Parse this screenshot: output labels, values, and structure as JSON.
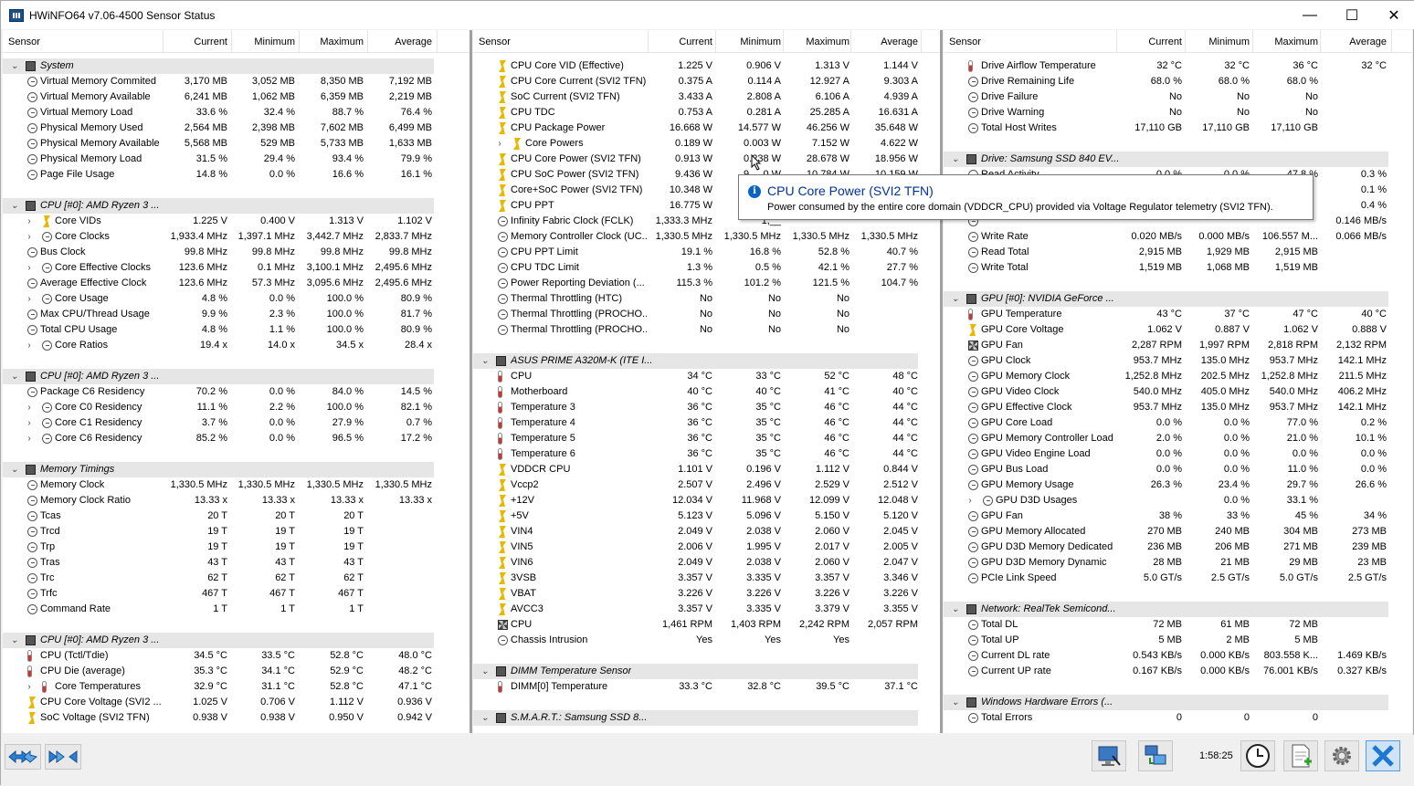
{
  "window": {
    "title": "HWiNFO64 v7.06-4500 Sensor Status",
    "minimize": "—",
    "maximize": "☐",
    "close": "✕"
  },
  "columns": {
    "sensor": "Sensor",
    "current": "Current",
    "minimum": "Minimum",
    "maximum": "Maximum",
    "average": "Average"
  },
  "panel1": [
    {
      "t": "sec",
      "l": "System",
      "i": "chip",
      "lv": 0
    },
    {
      "l": "Virtual Memory Commited",
      "i": "clock",
      "c": "3,170 MB",
      "mn": "3,052 MB",
      "mx": "8,350 MB",
      "av": "7,192 MB"
    },
    {
      "l": "Virtual Memory Available",
      "i": "clock",
      "c": "6,241 MB",
      "mn": "1,062 MB",
      "mx": "6,359 MB",
      "av": "2,219 MB"
    },
    {
      "l": "Virtual Memory Load",
      "i": "clock",
      "c": "33.6 %",
      "mn": "32.4 %",
      "mx": "88.7 %",
      "av": "76.4 %"
    },
    {
      "l": "Physical Memory Used",
      "i": "clock",
      "c": "2,564 MB",
      "mn": "2,398 MB",
      "mx": "7,602 MB",
      "av": "6,499 MB"
    },
    {
      "l": "Physical Memory Available",
      "i": "clock",
      "c": "5,568 MB",
      "mn": "529 MB",
      "mx": "5,733 MB",
      "av": "1,633 MB"
    },
    {
      "l": "Physical Memory Load",
      "i": "clock",
      "c": "31.5 %",
      "mn": "29.4 %",
      "mx": "93.4 %",
      "av": "79.9 %"
    },
    {
      "l": "Page File Usage",
      "i": "clock",
      "c": "14.8 %",
      "mn": "0.0 %",
      "mx": "16.6 %",
      "av": "16.1 %"
    },
    {
      "t": "blank"
    },
    {
      "t": "sec",
      "l": "CPU [#0]: AMD Ryzen 3 ...",
      "i": "chip"
    },
    {
      "l": "Core VIDs",
      "i": "volt",
      "e": 1,
      "c": "1.225 V",
      "mn": "0.400 V",
      "mx": "1.313 V",
      "av": "1.102 V"
    },
    {
      "l": "Core Clocks",
      "i": "clock",
      "e": 1,
      "c": "1,933.4 MHz",
      "mn": "1,397.1 MHz",
      "mx": "3,442.7 MHz",
      "av": "2,833.7 MHz"
    },
    {
      "l": "Bus Clock",
      "i": "clock",
      "c": "99.8 MHz",
      "mn": "99.8 MHz",
      "mx": "99.8 MHz",
      "av": "99.8 MHz"
    },
    {
      "l": "Core Effective Clocks",
      "i": "clock",
      "e": 1,
      "c": "123.6 MHz",
      "mn": "0.1 MHz",
      "mx": "3,100.1 MHz",
      "av": "2,495.6 MHz"
    },
    {
      "l": "Average Effective Clock",
      "i": "clock",
      "c": "123.6 MHz",
      "mn": "57.3 MHz",
      "mx": "3,095.6 MHz",
      "av": "2,495.6 MHz"
    },
    {
      "l": "Core Usage",
      "i": "clock",
      "e": 1,
      "c": "4.8 %",
      "mn": "0.0 %",
      "mx": "100.0 %",
      "av": "80.9 %"
    },
    {
      "l": "Max CPU/Thread Usage",
      "i": "clock",
      "c": "9.9 %",
      "mn": "2.3 %",
      "mx": "100.0 %",
      "av": "81.7 %"
    },
    {
      "l": "Total CPU Usage",
      "i": "clock",
      "c": "4.8 %",
      "mn": "1.1 %",
      "mx": "100.0 %",
      "av": "80.9 %"
    },
    {
      "l": "Core Ratios",
      "i": "clock",
      "e": 1,
      "c": "19.4 x",
      "mn": "14.0 x",
      "mx": "34.5 x",
      "av": "28.4 x"
    },
    {
      "t": "blank"
    },
    {
      "t": "sec",
      "l": "CPU [#0]: AMD Ryzen 3 ...",
      "i": "chip"
    },
    {
      "l": "Package C6 Residency",
      "i": "clock",
      "c": "70.2 %",
      "mn": "0.0 %",
      "mx": "84.0 %",
      "av": "14.5 %"
    },
    {
      "l": "Core C0 Residency",
      "i": "clock",
      "e": 1,
      "c": "11.1 %",
      "mn": "2.2 %",
      "mx": "100.0 %",
      "av": "82.1 %"
    },
    {
      "l": "Core C1 Residency",
      "i": "clock",
      "e": 1,
      "c": "3.7 %",
      "mn": "0.0 %",
      "mx": "27.9 %",
      "av": "0.7 %"
    },
    {
      "l": "Core C6 Residency",
      "i": "clock",
      "e": 1,
      "c": "85.2 %",
      "mn": "0.0 %",
      "mx": "96.5 %",
      "av": "17.2 %"
    },
    {
      "t": "blank"
    },
    {
      "t": "sec",
      "l": "Memory Timings",
      "i": "chip"
    },
    {
      "l": "Memory Clock",
      "i": "clock",
      "c": "1,330.5 MHz",
      "mn": "1,330.5 MHz",
      "mx": "1,330.5 MHz",
      "av": "1,330.5 MHz"
    },
    {
      "l": "Memory Clock Ratio",
      "i": "clock",
      "c": "13.33 x",
      "mn": "13.33 x",
      "mx": "13.33 x",
      "av": "13.33 x"
    },
    {
      "l": "Tcas",
      "i": "clock",
      "c": "20 T",
      "mn": "20 T",
      "mx": "20 T",
      "av": ""
    },
    {
      "l": "Trcd",
      "i": "clock",
      "c": "19 T",
      "mn": "19 T",
      "mx": "19 T",
      "av": ""
    },
    {
      "l": "Trp",
      "i": "clock",
      "c": "19 T",
      "mn": "19 T",
      "mx": "19 T",
      "av": ""
    },
    {
      "l": "Tras",
      "i": "clock",
      "c": "43 T",
      "mn": "43 T",
      "mx": "43 T",
      "av": ""
    },
    {
      "l": "Trc",
      "i": "clock",
      "c": "62 T",
      "mn": "62 T",
      "mx": "62 T",
      "av": ""
    },
    {
      "l": "Trfc",
      "i": "clock",
      "c": "467 T",
      "mn": "467 T",
      "mx": "467 T",
      "av": ""
    },
    {
      "l": "Command Rate",
      "i": "clock",
      "c": "1 T",
      "mn": "1 T",
      "mx": "1 T",
      "av": ""
    },
    {
      "t": "blank"
    },
    {
      "t": "sec",
      "l": "CPU [#0]: AMD Ryzen 3 ...",
      "i": "chip"
    },
    {
      "l": "CPU (Tctl/Tdie)",
      "i": "temp",
      "c": "34.5 °C",
      "mn": "33.5 °C",
      "mx": "52.8 °C",
      "av": "48.0 °C"
    },
    {
      "l": "CPU Die (average)",
      "i": "temp",
      "c": "35.3 °C",
      "mn": "34.1 °C",
      "mx": "52.9 °C",
      "av": "48.2 °C"
    },
    {
      "l": "Core Temperatures",
      "i": "temp",
      "e": 1,
      "c": "32.9 °C",
      "mn": "31.1 °C",
      "mx": "52.8 °C",
      "av": "47.1 °C"
    },
    {
      "l": "CPU Core Voltage (SVI2 ...",
      "i": "volt",
      "c": "1.025 V",
      "mn": "0.706 V",
      "mx": "1.112 V",
      "av": "0.936 V"
    },
    {
      "l": "SoC Voltage (SVI2 TFN)",
      "i": "volt",
      "c": "0.938 V",
      "mn": "0.938 V",
      "mx": "0.950 V",
      "av": "0.942 V"
    }
  ],
  "panel2": [
    {
      "l": "CPU Core VID (Effective)",
      "i": "volt",
      "c": "1.225 V",
      "mn": "0.906 V",
      "mx": "1.313 V",
      "av": "1.144 V"
    },
    {
      "l": "CPU Core Current (SVI2 TFN)",
      "i": "volt",
      "c": "0.375 A",
      "mn": "0.114 A",
      "mx": "12.927 A",
      "av": "9.303 A"
    },
    {
      "l": "SoC Current (SVI2 TFN)",
      "i": "volt",
      "c": "3.433 A",
      "mn": "2.808 A",
      "mx": "6.106 A",
      "av": "4.939 A"
    },
    {
      "l": "CPU TDC",
      "i": "volt",
      "c": "0.753 A",
      "mn": "0.281 A",
      "mx": "25.285 A",
      "av": "16.631 A"
    },
    {
      "l": "CPU Package Power",
      "i": "volt",
      "c": "16.668 W",
      "mn": "14.577 W",
      "mx": "46.256 W",
      "av": "35.648 W"
    },
    {
      "l": "Core Powers",
      "i": "volt",
      "e": 1,
      "c": "0.189 W",
      "mn": "0.003 W",
      "mx": "7.152 W",
      "av": "4.622 W"
    },
    {
      "l": "CPU Core Power (SVI2 TFN)",
      "i": "volt",
      "c": "0.913 W",
      "mn": "0.238 W",
      "mx": "28.678 W",
      "av": "18.956 W"
    },
    {
      "l": "CPU SoC Power (SVI2 TFN)",
      "i": "volt",
      "c": "9.436 W",
      "mn": "9.__0 W",
      "mx": "10.784 W",
      "av": "10.159 W"
    },
    {
      "l": "Core+SoC Power (SVI2 TFN)",
      "i": "volt",
      "c": "10.348 W",
      "mn": "",
      "mx": "",
      "av": ""
    },
    {
      "l": "CPU PPT",
      "i": "volt",
      "c": "16.775 W",
      "mn": "",
      "mx": "",
      "av": ""
    },
    {
      "l": "Infinity Fabric Clock (FCLK)",
      "i": "clock",
      "c": "1,333.3 MHz",
      "mn": "1,__",
      "mx": "",
      "av": ""
    },
    {
      "l": "Memory Controller Clock (UC...",
      "i": "clock",
      "c": "1,330.5 MHz",
      "mn": "1,330.5 MHz",
      "mx": "1,330.5 MHz",
      "av": "1,330.5 MHz"
    },
    {
      "l": "CPU PPT Limit",
      "i": "clock",
      "c": "19.1 %",
      "mn": "16.8 %",
      "mx": "52.8 %",
      "av": "40.7 %"
    },
    {
      "l": "CPU TDC Limit",
      "i": "clock",
      "c": "1.3 %",
      "mn": "0.5 %",
      "mx": "42.1 %",
      "av": "27.7 %"
    },
    {
      "l": "Power Reporting Deviation (...",
      "i": "clock",
      "c": "115.3 %",
      "mn": "101.2 %",
      "mx": "121.5 %",
      "av": "104.7 %"
    },
    {
      "l": "Thermal Throttling (HTC)",
      "i": "clock",
      "c": "No",
      "mn": "No",
      "mx": "No",
      "av": ""
    },
    {
      "l": "Thermal Throttling (PROCHO...",
      "i": "clock",
      "c": "No",
      "mn": "No",
      "mx": "No",
      "av": ""
    },
    {
      "l": "Thermal Throttling (PROCHO...",
      "i": "clock",
      "c": "No",
      "mn": "No",
      "mx": "No",
      "av": ""
    },
    {
      "t": "blank"
    },
    {
      "t": "sec",
      "l": "ASUS PRIME A320M-K (ITE I...",
      "i": "chip"
    },
    {
      "l": "CPU",
      "i": "temp",
      "c": "34 °C",
      "mn": "33 °C",
      "mx": "52 °C",
      "av": "48 °C"
    },
    {
      "l": "Motherboard",
      "i": "temp",
      "c": "40 °C",
      "mn": "40 °C",
      "mx": "41 °C",
      "av": "40 °C"
    },
    {
      "l": "Temperature 3",
      "i": "temp",
      "c": "36 °C",
      "mn": "35 °C",
      "mx": "46 °C",
      "av": "44 °C"
    },
    {
      "l": "Temperature 4",
      "i": "temp",
      "c": "36 °C",
      "mn": "35 °C",
      "mx": "46 °C",
      "av": "44 °C"
    },
    {
      "l": "Temperature 5",
      "i": "temp",
      "c": "36 °C",
      "mn": "35 °C",
      "mx": "46 °C",
      "av": "44 °C"
    },
    {
      "l": "Temperature 6",
      "i": "temp",
      "c": "36 °C",
      "mn": "35 °C",
      "mx": "46 °C",
      "av": "44 °C"
    },
    {
      "l": "VDDCR CPU",
      "i": "volt",
      "c": "1.101 V",
      "mn": "0.196 V",
      "mx": "1.112 V",
      "av": "0.844 V"
    },
    {
      "l": "Vccp2",
      "i": "volt",
      "c": "2.507 V",
      "mn": "2.496 V",
      "mx": "2.529 V",
      "av": "2.512 V"
    },
    {
      "l": "+12V",
      "i": "volt",
      "c": "12.034 V",
      "mn": "11.968 V",
      "mx": "12.099 V",
      "av": "12.048 V"
    },
    {
      "l": "+5V",
      "i": "volt",
      "c": "5.123 V",
      "mn": "5.096 V",
      "mx": "5.150 V",
      "av": "5.120 V"
    },
    {
      "l": "VIN4",
      "i": "volt",
      "c": "2.049 V",
      "mn": "2.038 V",
      "mx": "2.060 V",
      "av": "2.045 V"
    },
    {
      "l": "VIN5",
      "i": "volt",
      "c": "2.006 V",
      "mn": "1.995 V",
      "mx": "2.017 V",
      "av": "2.005 V"
    },
    {
      "l": "VIN6",
      "i": "volt",
      "c": "2.049 V",
      "mn": "2.038 V",
      "mx": "2.060 V",
      "av": "2.047 V"
    },
    {
      "l": "3VSB",
      "i": "volt",
      "c": "3.357 V",
      "mn": "3.335 V",
      "mx": "3.357 V",
      "av": "3.346 V"
    },
    {
      "l": "VBAT",
      "i": "volt",
      "c": "3.226 V",
      "mn": "3.226 V",
      "mx": "3.226 V",
      "av": "3.226 V"
    },
    {
      "l": "AVCC3",
      "i": "volt",
      "c": "3.357 V",
      "mn": "3.335 V",
      "mx": "3.379 V",
      "av": "3.355 V"
    },
    {
      "l": "CPU",
      "i": "fan",
      "c": "1,461 RPM",
      "mn": "1,403 RPM",
      "mx": "2,242 RPM",
      "av": "2,057 RPM"
    },
    {
      "l": "Chassis Intrusion",
      "i": "clock",
      "c": "Yes",
      "mn": "Yes",
      "mx": "Yes",
      "av": ""
    },
    {
      "t": "blank"
    },
    {
      "t": "sec",
      "l": "DIMM Temperature Sensor",
      "i": "chip"
    },
    {
      "l": "DIMM[0] Temperature",
      "i": "temp",
      "c": "33.3 °C",
      "mn": "32.8 °C",
      "mx": "39.5 °C",
      "av": "37.1 °C"
    },
    {
      "t": "blank"
    },
    {
      "t": "sec",
      "l": "S.M.A.R.T.: Samsung SSD 8...",
      "i": "chip"
    }
  ],
  "panel3": [
    {
      "l": "Drive Airflow Temperature",
      "i": "temp",
      "c": "32 °C",
      "mn": "32 °C",
      "mx": "36 °C",
      "av": "32 °C"
    },
    {
      "l": "Drive Remaining Life",
      "i": "clock",
      "c": "68.0 %",
      "mn": "68.0 %",
      "mx": "68.0 %",
      "av": ""
    },
    {
      "l": "Drive Failure",
      "i": "clock",
      "c": "No",
      "mn": "No",
      "mx": "No",
      "av": ""
    },
    {
      "l": "Drive Warning",
      "i": "clock",
      "c": "No",
      "mn": "No",
      "mx": "No",
      "av": ""
    },
    {
      "l": "Total Host Writes",
      "i": "clock",
      "c": "17,110 GB",
      "mn": "17,110 GB",
      "mx": "17,110 GB",
      "av": ""
    },
    {
      "t": "blank"
    },
    {
      "t": "sec",
      "l": "Drive: Samsung SSD 840 EV...",
      "i": "chip"
    },
    {
      "l": "Read Activity",
      "i": "clock",
      "c": "0.0 %",
      "mn": "0.0 %",
      "mx": "47.8 %",
      "av": "0.3 %"
    },
    {
      "l": "",
      "i": "clock",
      "c": "",
      "mn": "",
      "mx": "",
      "av": "0.1 %"
    },
    {
      "l": "",
      "i": "clock",
      "c": "",
      "mn": "",
      "mx": "",
      "av": "0.4 %"
    },
    {
      "l": "",
      "i": "clock",
      "c": "",
      "mn": "",
      "mx": "",
      "av": "0.146 MB/s"
    },
    {
      "l": "Write Rate",
      "i": "clock",
      "c": "0.020 MB/s",
      "mn": "0.000 MB/s",
      "mx": "106.557 M...",
      "av": "0.066 MB/s"
    },
    {
      "l": "Read Total",
      "i": "clock",
      "c": "2,915 MB",
      "mn": "1,929 MB",
      "mx": "2,915 MB",
      "av": ""
    },
    {
      "l": "Write Total",
      "i": "clock",
      "c": "1,519 MB",
      "mn": "1,068 MB",
      "mx": "1,519 MB",
      "av": ""
    },
    {
      "t": "blank"
    },
    {
      "t": "sec",
      "l": "GPU [#0]: NVIDIA GeForce ...",
      "i": "chip"
    },
    {
      "l": "GPU Temperature",
      "i": "temp",
      "c": "43 °C",
      "mn": "37 °C",
      "mx": "47 °C",
      "av": "40 °C"
    },
    {
      "l": "GPU Core Voltage",
      "i": "volt",
      "c": "1.062 V",
      "mn": "0.887 V",
      "mx": "1.062 V",
      "av": "0.888 V"
    },
    {
      "l": "GPU Fan",
      "i": "fan",
      "c": "2,287 RPM",
      "mn": "1,997 RPM",
      "mx": "2,818 RPM",
      "av": "2,132 RPM"
    },
    {
      "l": "GPU Clock",
      "i": "clock",
      "c": "953.7 MHz",
      "mn": "135.0 MHz",
      "mx": "953.7 MHz",
      "av": "142.1 MHz"
    },
    {
      "l": "GPU Memory Clock",
      "i": "clock",
      "c": "1,252.8 MHz",
      "mn": "202.5 MHz",
      "mx": "1,252.8 MHz",
      "av": "211.5 MHz"
    },
    {
      "l": "GPU Video Clock",
      "i": "clock",
      "c": "540.0 MHz",
      "mn": "405.0 MHz",
      "mx": "540.0 MHz",
      "av": "406.2 MHz"
    },
    {
      "l": "GPU Effective Clock",
      "i": "clock",
      "c": "953.7 MHz",
      "mn": "135.0 MHz",
      "mx": "953.7 MHz",
      "av": "142.1 MHz"
    },
    {
      "l": "GPU Core Load",
      "i": "clock",
      "c": "0.0 %",
      "mn": "0.0 %",
      "mx": "77.0 %",
      "av": "0.2 %"
    },
    {
      "l": "GPU Memory Controller Load",
      "i": "clock",
      "c": "2.0 %",
      "mn": "0.0 %",
      "mx": "21.0 %",
      "av": "10.1 %"
    },
    {
      "l": "GPU Video Engine Load",
      "i": "clock",
      "c": "0.0 %",
      "mn": "0.0 %",
      "mx": "0.0 %",
      "av": "0.0 %"
    },
    {
      "l": "GPU Bus Load",
      "i": "clock",
      "c": "0.0 %",
      "mn": "0.0 %",
      "mx": "11.0 %",
      "av": "0.0 %"
    },
    {
      "l": "GPU Memory Usage",
      "i": "clock",
      "c": "26.3 %",
      "mn": "23.4 %",
      "mx": "29.7 %",
      "av": "26.6 %"
    },
    {
      "l": "GPU D3D Usages",
      "i": "clock",
      "e": 1,
      "c": "",
      "mn": "0.0 %",
      "mx": "33.1 %",
      "av": ""
    },
    {
      "l": "GPU Fan",
      "i": "clock",
      "c": "38 %",
      "mn": "33 %",
      "mx": "45 %",
      "av": "34 %"
    },
    {
      "l": "GPU Memory Allocated",
      "i": "clock",
      "c": "270 MB",
      "mn": "240 MB",
      "mx": "304 MB",
      "av": "273 MB"
    },
    {
      "l": "GPU D3D Memory Dedicated",
      "i": "clock",
      "c": "236 MB",
      "mn": "206 MB",
      "mx": "271 MB",
      "av": "239 MB"
    },
    {
      "l": "GPU D3D Memory Dynamic",
      "i": "clock",
      "c": "28 MB",
      "mn": "21 MB",
      "mx": "29 MB",
      "av": "23 MB"
    },
    {
      "l": "PCIe Link Speed",
      "i": "clock",
      "c": "5.0 GT/s",
      "mn": "2.5 GT/s",
      "mx": "5.0 GT/s",
      "av": "2.5 GT/s"
    },
    {
      "t": "blank"
    },
    {
      "t": "sec",
      "l": "Network: RealTek Semicond...",
      "i": "chip"
    },
    {
      "l": "Total DL",
      "i": "clock",
      "c": "72 MB",
      "mn": "61 MB",
      "mx": "72 MB",
      "av": ""
    },
    {
      "l": "Total UP",
      "i": "clock",
      "c": "5 MB",
      "mn": "2 MB",
      "mx": "5 MB",
      "av": ""
    },
    {
      "l": "Current DL rate",
      "i": "clock",
      "c": "0.543 KB/s",
      "mn": "0.000 KB/s",
      "mx": "803.558 K...",
      "av": "1.469 KB/s"
    },
    {
      "l": "Current UP rate",
      "i": "clock",
      "c": "0.167 KB/s",
      "mn": "0.000 KB/s",
      "mx": "76.001 KB/s",
      "av": "0.327 KB/s"
    },
    {
      "t": "blank"
    },
    {
      "t": "sec",
      "l": "Windows Hardware Errors (...",
      "i": "chip"
    },
    {
      "l": "Total Errors",
      "i": "clock",
      "c": "0",
      "mn": "0",
      "mx": "0",
      "av": ""
    }
  ],
  "tooltip": {
    "title": "CPU Core Power (SVI2 TFN)",
    "body": "Power consumed by the entire core domain (VDDCR_CPU) provided via Voltage Regulator telemetry (SVI2 TFN).",
    "icon": "info-icon"
  },
  "statusbar": {
    "timer": "1:58:25"
  },
  "colors": {
    "section_bg": "#e6e6e6",
    "tooltip_title": "#003399",
    "volt_icon": "#e6b800",
    "close_button": "#1e78d2"
  }
}
